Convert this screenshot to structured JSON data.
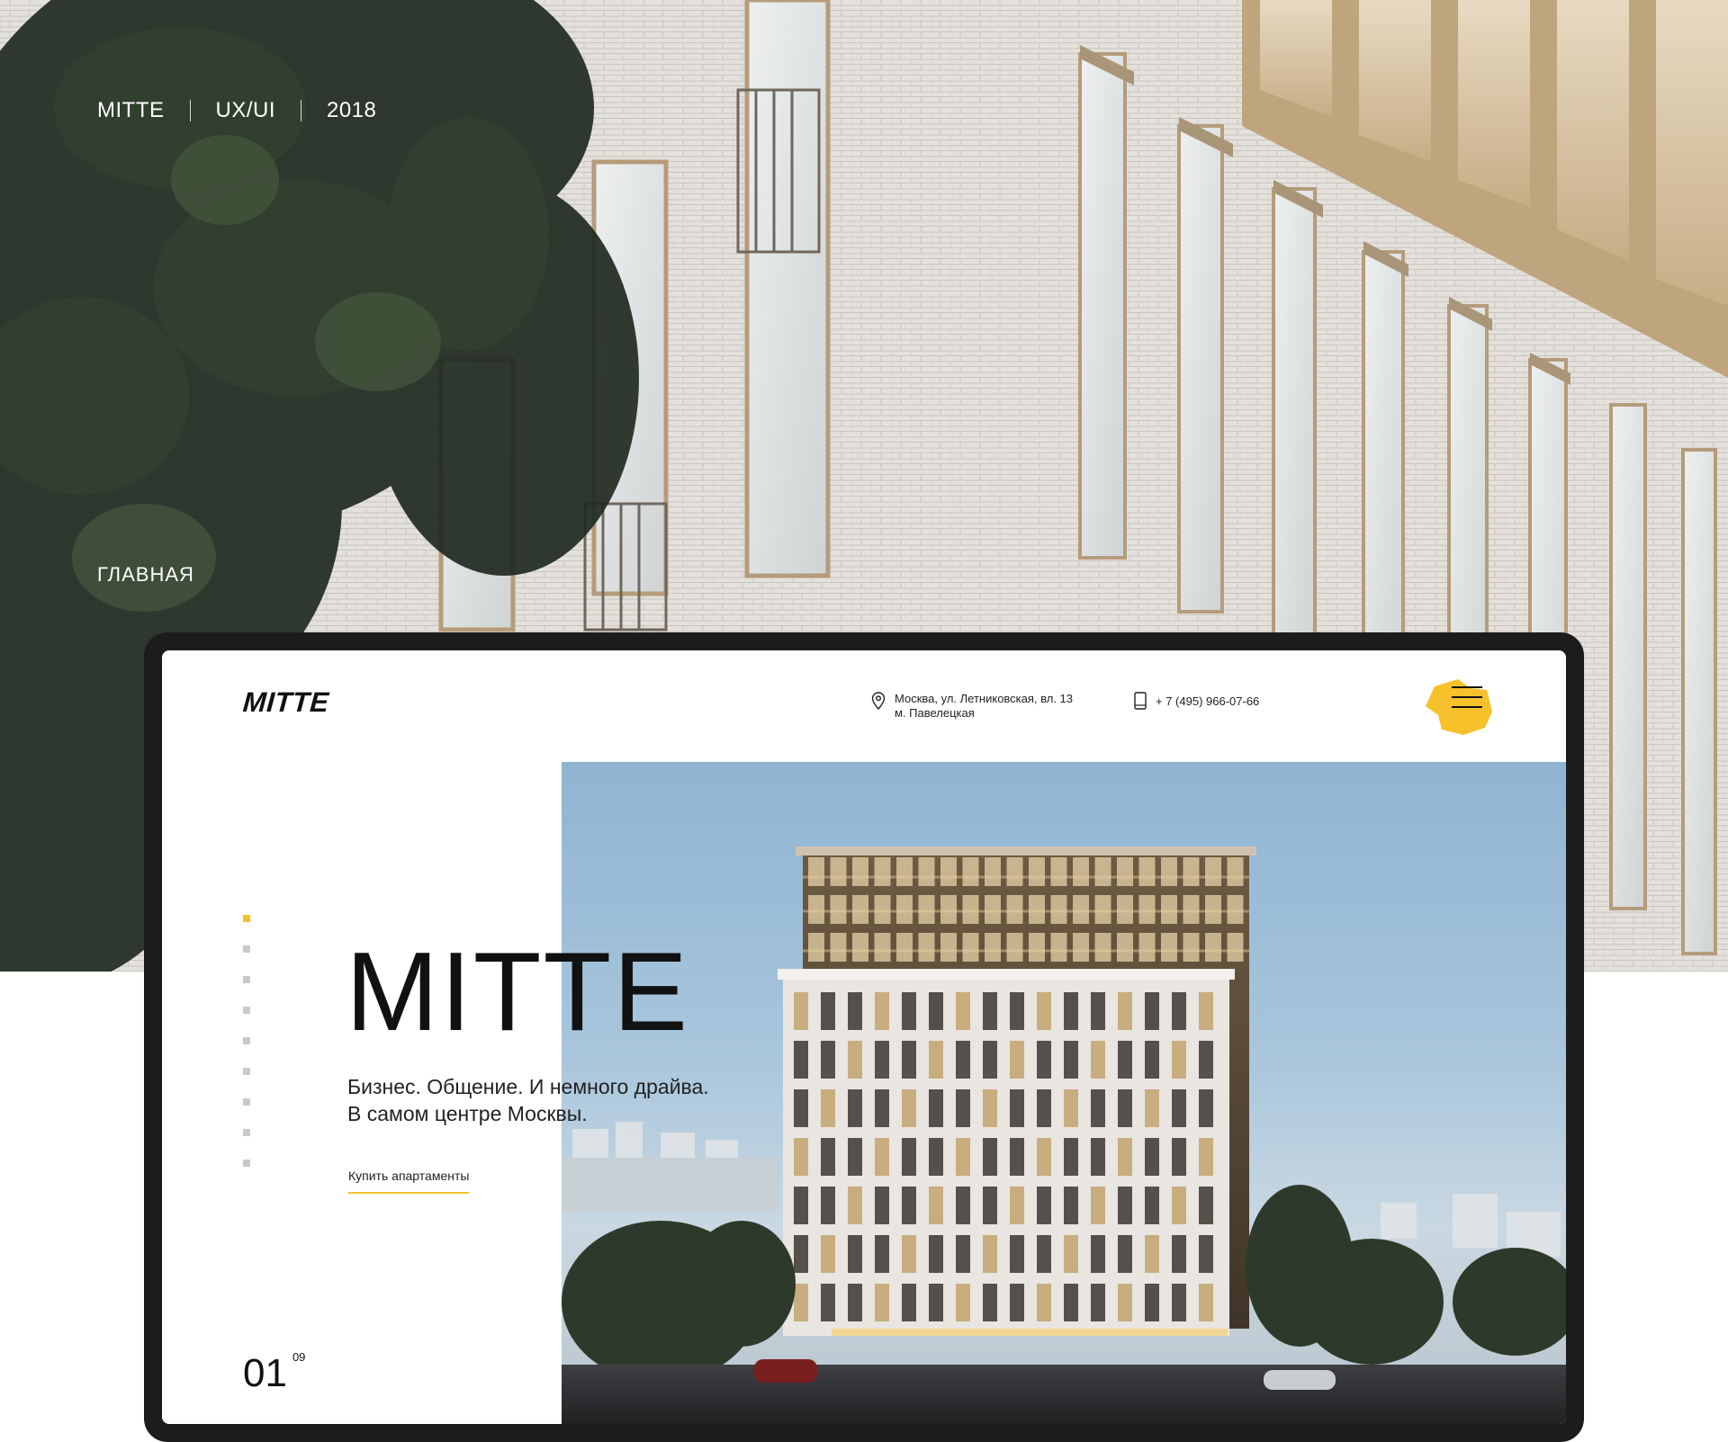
{
  "case": {
    "project": "MITTE",
    "discipline": "UX/UI",
    "year": "2018",
    "section": "ГЛАВНАЯ"
  },
  "site": {
    "logo": "MITTE",
    "address_line1": "Москва, ул. Летниковская, вл. 13",
    "address_line2": "м. Павелецкая",
    "phone": "+ 7 (495) 966-07-66",
    "hero_title": "MITTE",
    "hero_subtitle_line1": "Бизнес. Общение. И немного драйва.",
    "hero_subtitle_line2": "В самом центре Москвы.",
    "cta_label": "Купить апартаменты",
    "slide_current": "01",
    "slide_total": "09",
    "slide_dots": 9,
    "active_dot_index": 0
  },
  "icons": {
    "location": "location-pin-icon",
    "phone": "phone-icon",
    "menu": "hamburger-menu-icon"
  },
  "colors": {
    "accent": "#f6c12b",
    "text": "#111111",
    "device_frame": "#1c1c1c"
  }
}
